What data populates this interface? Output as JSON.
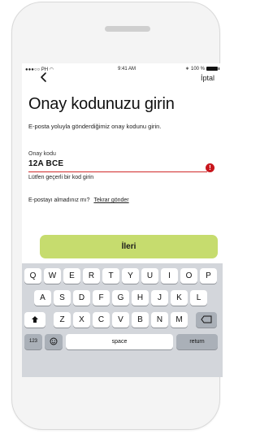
{
  "status_bar": {
    "carrier": "●●●○○ PH ",
    "time": "9:41 AM",
    "battery": "100 %"
  },
  "nav": {
    "cancel_label": "İptal"
  },
  "page": {
    "title": "Onay kodunuzu girin",
    "description": "E-posta yoluyla gönderdiğimiz onay kodunu girin."
  },
  "field": {
    "label": "Onay kodu",
    "value": "12A BCE",
    "error_message": "Lütfen geçerli bir kod girin",
    "error_icon": "!"
  },
  "resend": {
    "prompt": "E-postayı almadınız mı?",
    "link_label": "Tekrar gönder"
  },
  "next_button": {
    "label": "İleri"
  },
  "keyboard": {
    "row1": [
      "Q",
      "W",
      "E",
      "R",
      "T",
      "Y",
      "U",
      "I",
      "O",
      "P"
    ],
    "row2": [
      "A",
      "S",
      "D",
      "F",
      "G",
      "H",
      "J",
      "K",
      "L"
    ],
    "row3": [
      "Z",
      "X",
      "C",
      "V",
      "B",
      "N",
      "M"
    ],
    "numbers_label": "123",
    "space_label": "space",
    "return_label": "return"
  },
  "colors": {
    "accent_button": "#c6dc6e",
    "error": "#c8161d"
  }
}
